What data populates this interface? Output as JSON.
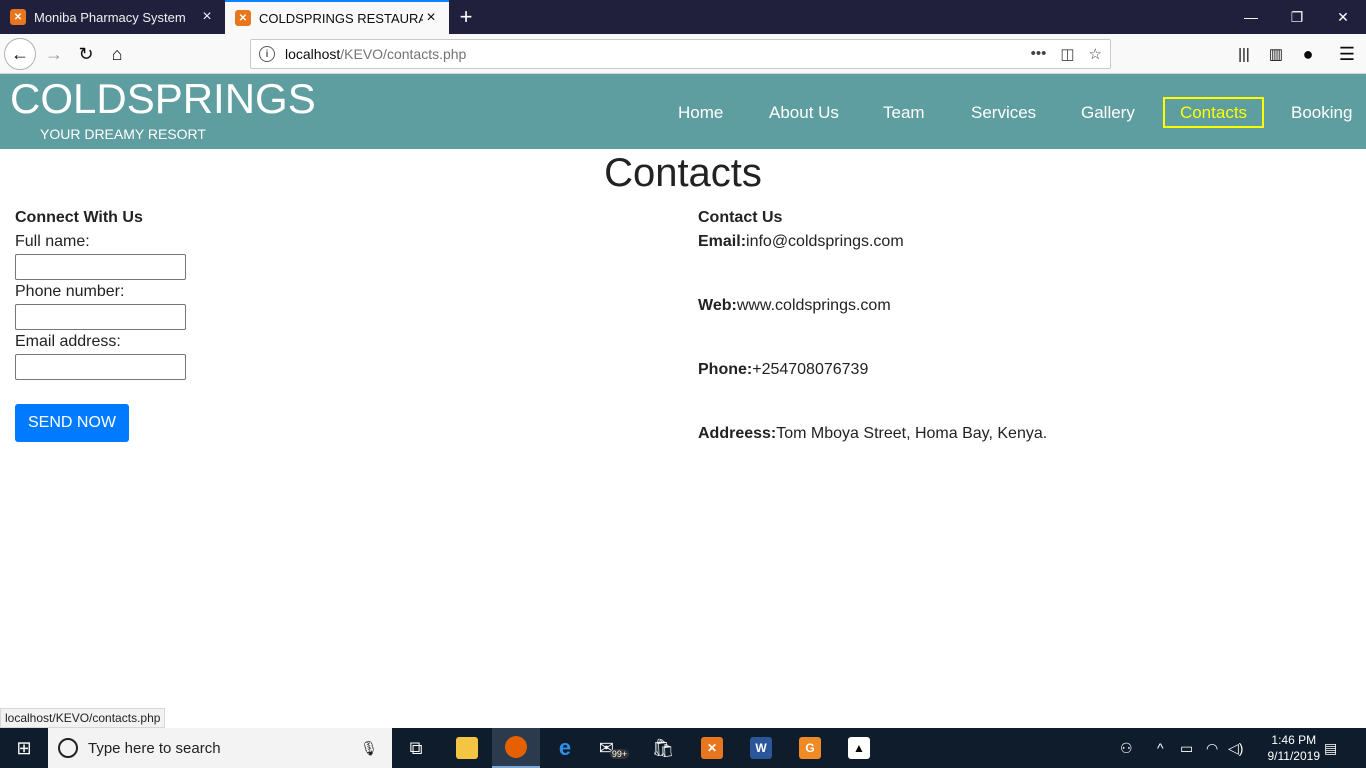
{
  "browser": {
    "tabs": [
      {
        "title": "Moniba Pharmacy System",
        "active": false
      },
      {
        "title": "COLDSPRINGS RESTAURANT",
        "active": true
      }
    ],
    "url_host": "localhost",
    "url_path": "/KEVO/contacts.php",
    "status_text": "localhost/KEVO/contacts.php"
  },
  "site": {
    "brand": "COLDSPRINGS",
    "tagline": "YOUR DREAMY RESORT",
    "nav": [
      "Home",
      "About Us",
      "Team",
      "Services",
      "Gallery",
      "Contacts",
      "Booking"
    ],
    "active_nav": "Contacts",
    "header_color": "#5f9ea0",
    "active_color": "#ffff00"
  },
  "page": {
    "heading": "Contacts",
    "form": {
      "title": "Connect With Us",
      "full_name_label": "Full name:",
      "full_name_value": "",
      "phone_label": "Phone number:",
      "phone_value": "",
      "email_label": "Email address:",
      "email_value": "",
      "submit_label": "SEND NOW"
    },
    "contact": {
      "title": "Contact Us",
      "email_label": "Email:",
      "email_value": "info@coldsprings.com",
      "web_label": "Web:",
      "web_value": "www.coldsprings.com",
      "phone_label": "Phone:",
      "phone_value": "+254708076739",
      "address_label": "Addreess:",
      "address_value": "Tom Mboya Street, Homa Bay, Kenya."
    }
  },
  "taskbar": {
    "search_placeholder": "Type here to search",
    "mail_badge": "99+",
    "time": "1:46 PM",
    "date": "9/11/2019"
  }
}
